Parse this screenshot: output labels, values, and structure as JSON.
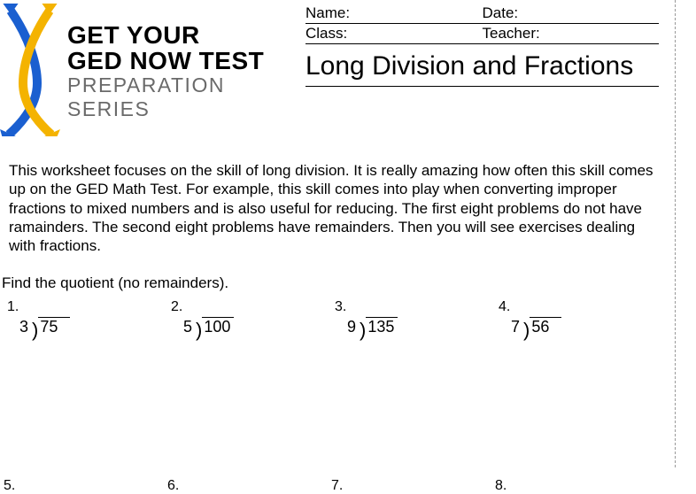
{
  "brand": {
    "line1": "GET YOUR",
    "line2": "GED NOW TEST",
    "line3": "PREPARATION SERIES"
  },
  "meta": {
    "name_label": "Name:",
    "date_label": "Date:",
    "class_label": "Class:",
    "teacher_label": "Teacher:"
  },
  "title": "Long Division and Fractions",
  "intro": "This worksheet focuses on the skill of long division. It is really amazing how often this skill comes up on the GED Math Test. For example, this skill comes into play when converting improper fractions to mixed numbers and is also useful for reducing. The first eight problems do not have ramainders. The second eight problems have remainders. Then you will see exercises dealing with fractions.",
  "section1_label": "Find the quotient (no remainders).",
  "problems_row1": [
    {
      "num": "1.",
      "divisor": "3",
      "dividend": "75"
    },
    {
      "num": "2.",
      "divisor": "5",
      "dividend": "100"
    },
    {
      "num": "3.",
      "divisor": "9",
      "dividend": "135"
    },
    {
      "num": "4.",
      "divisor": "7",
      "dividend": "56"
    }
  ],
  "problems_row2": [
    {
      "num": "5."
    },
    {
      "num": "6."
    },
    {
      "num": "7."
    },
    {
      "num": "8."
    }
  ]
}
